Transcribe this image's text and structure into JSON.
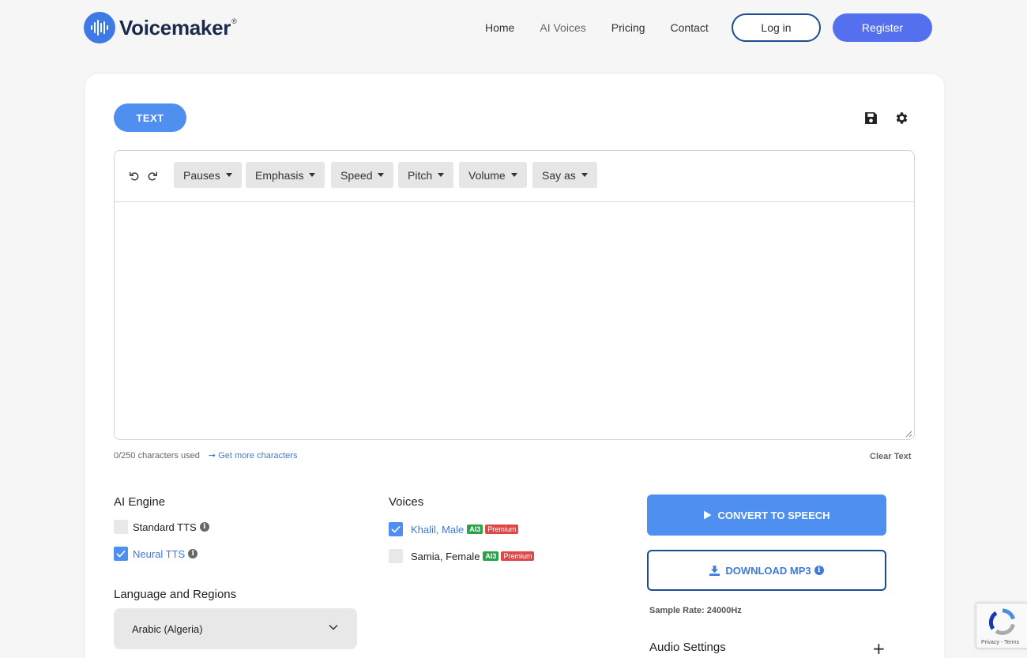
{
  "brand": {
    "name": "Voicemaker",
    "registered": "®",
    "color": "#3e7ae6"
  },
  "nav": {
    "home": "Home",
    "ai_voices": "AI Voices",
    "pricing": "Pricing",
    "contact": "Contact",
    "login": "Log in",
    "register": "Register"
  },
  "tabs": {
    "text": "TEXT"
  },
  "toolbar": {
    "pauses": "Pauses",
    "emphasis": "Emphasis",
    "speed": "Speed",
    "pitch": "Pitch",
    "volume": "Volume",
    "say_as": "Say as"
  },
  "editor": {
    "char_count": "0/250 characters used",
    "more_chars": "Get more characters",
    "clear": "Clear Text"
  },
  "engine": {
    "label": "AI Engine",
    "standard": "Standard TTS",
    "neural": "Neural TTS",
    "standard_checked": false,
    "neural_checked": true
  },
  "voices": {
    "label": "Voices",
    "items": [
      {
        "name": "Khalil, Male",
        "ai": "AI3",
        "premium": "Premium",
        "checked": true
      },
      {
        "name": "Samia, Female",
        "ai": "AI3",
        "premium": "Premium",
        "checked": false
      }
    ]
  },
  "language": {
    "label": "Language and Regions",
    "selected": "Arabic (Algeria)"
  },
  "actions": {
    "convert": "CONVERT TO SPEECH",
    "download": "DOWNLOAD MP3",
    "sample_rate": "Sample Rate: 24000Hz",
    "audio_settings": "Audio Settings",
    "expand": "+"
  },
  "recaptcha": {
    "text": "Privacy - Terms"
  },
  "colors": {
    "primary": "#4f8fef",
    "register": "#5470ef",
    "outline": "#1d4d8c",
    "ai_badge": "#2aa24a",
    "premium_badge": "#e04848"
  }
}
